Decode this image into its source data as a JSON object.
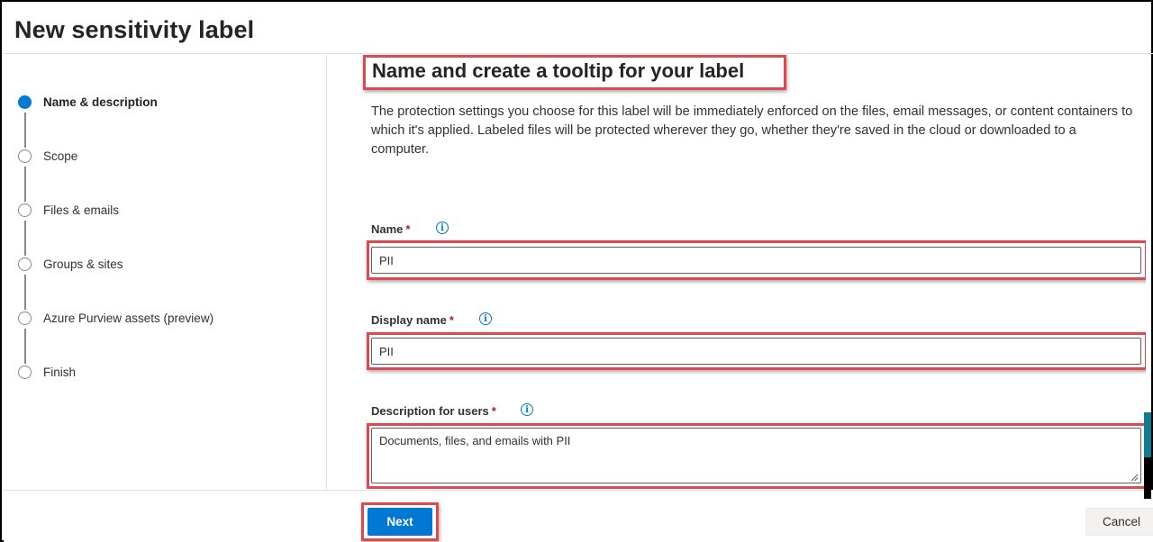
{
  "header": {
    "title": "New sensitivity label"
  },
  "steps": [
    {
      "label": "Name & description",
      "state": "active"
    },
    {
      "label": "Scope",
      "state": "pending"
    },
    {
      "label": "Files & emails",
      "state": "pending"
    },
    {
      "label": "Groups & sites",
      "state": "pending"
    },
    {
      "label": "Azure Purview assets (preview)",
      "state": "pending"
    },
    {
      "label": "Finish",
      "state": "pending"
    }
  ],
  "main": {
    "title": "Name and create a tooltip for your label",
    "description": "The protection settings you choose for this label will be immediately enforced on the files, email messages, or content containers to which it's applied. Labeled files will be protected wherever they go, whether they're saved in the cloud or downloaded to a computer.",
    "fields": {
      "name": {
        "label": "Name",
        "required_mark": "*",
        "value": "PII"
      },
      "display_name": {
        "label": "Display name",
        "required_mark": "*",
        "value": "PII"
      },
      "description": {
        "label": "Description for users",
        "required_mark": "*",
        "value": "Documents, files, and emails with PII"
      }
    },
    "info_icon_glyph": "i"
  },
  "footer": {
    "next_label": "Next",
    "cancel_label": "Cancel"
  },
  "colors": {
    "accent": "#0078d4",
    "highlight": "#e0484f",
    "required": "#a4262c"
  },
  "icons": {
    "info": "info-icon",
    "step": "step-circle-icon",
    "resize": "resize-grip-icon"
  }
}
